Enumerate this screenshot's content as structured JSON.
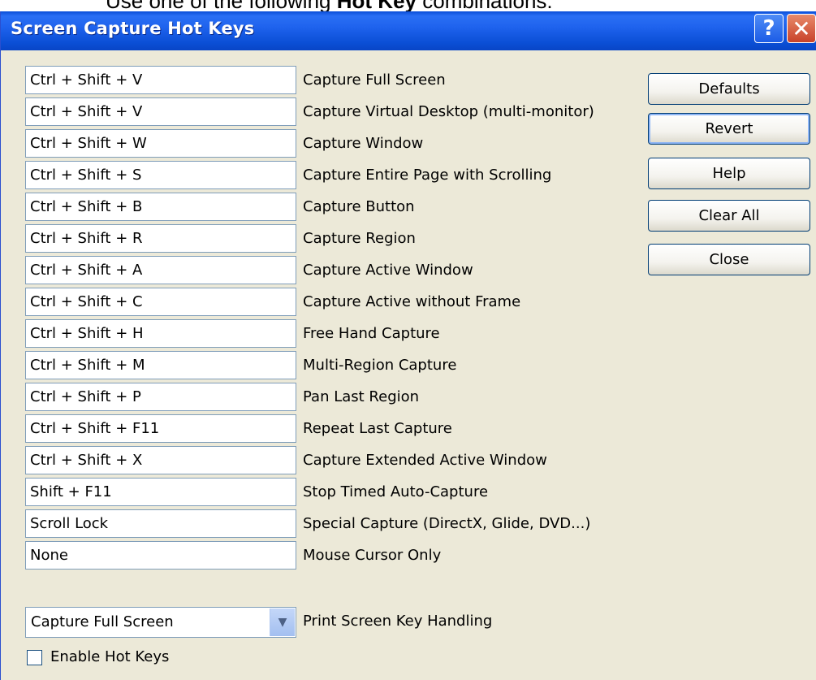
{
  "background_text": {
    "prefix": "Use one of the following",
    "bold": "Hot Key",
    "suffix": "combinations:"
  },
  "window": {
    "title": "Screen Capture Hot Keys",
    "help_glyph": "?",
    "close_glyph": "✕"
  },
  "hotkeys": [
    {
      "key": "Ctrl + Shift + V",
      "action": "Capture Full Screen"
    },
    {
      "key": "Ctrl + Shift + V",
      "action": "Capture Virtual Desktop (multi-monitor)"
    },
    {
      "key": "Ctrl + Shift + W",
      "action": "Capture Window"
    },
    {
      "key": "Ctrl + Shift + S",
      "action": "Capture Entire Page with Scrolling"
    },
    {
      "key": "Ctrl + Shift + B",
      "action": "Capture Button"
    },
    {
      "key": "Ctrl + Shift + R",
      "action": "Capture Region"
    },
    {
      "key": "Ctrl + Shift + A",
      "action": "Capture Active Window"
    },
    {
      "key": "Ctrl + Shift + C",
      "action": "Capture Active without Frame"
    },
    {
      "key": "Ctrl + Shift + H",
      "action": "Free Hand Capture"
    },
    {
      "key": "Ctrl + Shift + M",
      "action": "Multi-Region Capture"
    },
    {
      "key": "Ctrl + Shift + P",
      "action": "Pan Last Region"
    },
    {
      "key": "Ctrl + Shift + F11",
      "action": "Repeat Last Capture"
    },
    {
      "key": "Ctrl + Shift + X",
      "action": "Capture Extended Active Window"
    },
    {
      "key": "Shift + F11",
      "action": "Stop Timed Auto-Capture"
    },
    {
      "key": "Scroll Lock",
      "action": "Special Capture (DirectX, Glide, DVD...)"
    },
    {
      "key": "None",
      "action": "Mouse Cursor Only"
    }
  ],
  "buttons": {
    "defaults": "Defaults",
    "revert": "Revert",
    "help": "Help",
    "clear_all": "Clear All",
    "close": "Close"
  },
  "print_screen": {
    "selected": "Capture Full Screen",
    "label": "Print Screen Key Handling"
  },
  "enable_hot_keys": {
    "label": "Enable Hot Keys",
    "checked": false
  },
  "colors": {
    "titlebar": "#0b4fd6",
    "dialog_bg": "#ece9d8",
    "field_border": "#7f9db9",
    "button_border": "#003c74"
  }
}
